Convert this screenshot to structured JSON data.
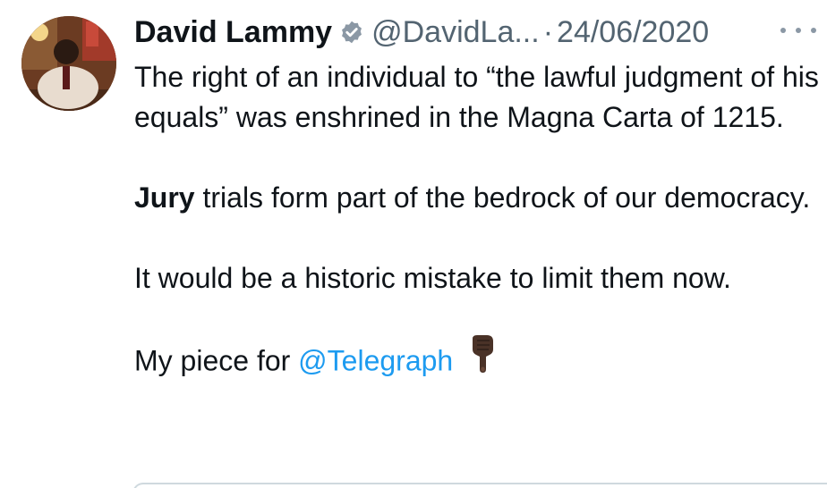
{
  "tweet": {
    "display_name": "David Lammy",
    "handle": "@DavidLa...",
    "separator": "·",
    "date": "24/06/2020",
    "paragraph1": "The right of an individual to “the lawful judgment of his equals” was enshrined in the Magna Carta of 1215.",
    "paragraph2_bold": "Jury",
    "paragraph2_rest": " trials form part of the bedrock of our democracy.",
    "paragraph3": "It would be a historic mistake to limit them now.",
    "paragraph4_prefix": "My piece for ",
    "mention": "@Telegraph",
    "icons": {
      "verified": "verified-badge-icon",
      "more": "more-options-icon",
      "emoji": "pointing-down-emoji"
    },
    "colors": {
      "text": "#0f1419",
      "secondary": "#536471",
      "link": "#1d9bf0"
    }
  }
}
